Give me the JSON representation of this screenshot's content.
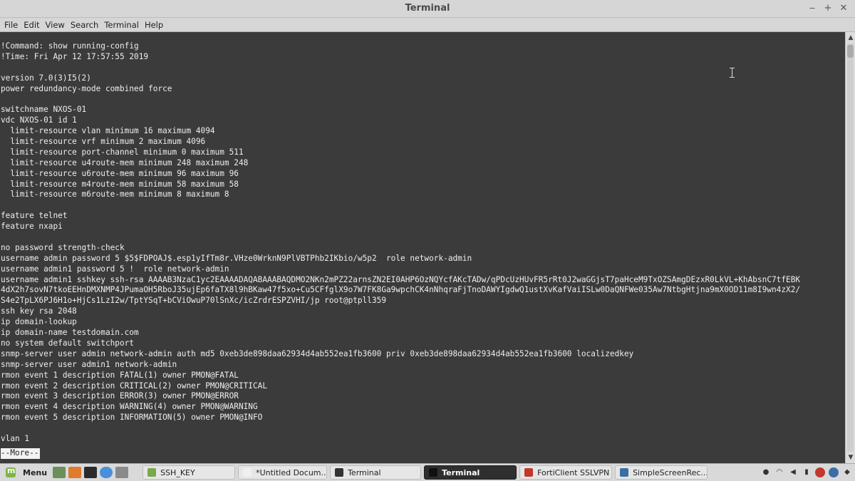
{
  "window": {
    "title": "Terminal"
  },
  "menu": [
    "File",
    "Edit",
    "View",
    "Search",
    "Terminal",
    "Help"
  ],
  "terminal": {
    "lines": [
      "!Command: show running-config",
      "!Time: Fri Apr 12 17:57:55 2019",
      "",
      "version 7.0(3)I5(2)",
      "power redundancy-mode combined force",
      "",
      "switchname NXOS-01",
      "vdc NXOS-01 id 1",
      "  limit-resource vlan minimum 16 maximum 4094",
      "  limit-resource vrf minimum 2 maximum 4096",
      "  limit-resource port-channel minimum 0 maximum 511",
      "  limit-resource u4route-mem minimum 248 maximum 248",
      "  limit-resource u6route-mem minimum 96 maximum 96",
      "  limit-resource m4route-mem minimum 58 maximum 58",
      "  limit-resource m6route-mem minimum 8 maximum 8",
      "",
      "feature telnet",
      "feature nxapi",
      "",
      "no password strength-check",
      "username admin password 5 $5$FDPOAJ$.esp1yIfTm8r.VHze0WrknN9PlVBTPhb2IKbio/w5p2  role network-admin",
      "username admin1 password 5 !  role network-admin",
      "username admin1 sshkey ssh-rsa AAAAB3NzaC1yc2EAAAADAQABAAABAQDMO2NKn2mPZ22arnsZN2EI0AHP6OzNQYcfAKcTADw/qPDcUzHUvFR5rRt0J2waGGjsT7paHceM9TxOZSAmgDEzxR0LkVL+KhAbsnC7tfEBK",
      "4dX2h7sovN7tkoEEHnDMXNMP4JPumaOH5RboJ35ujEp6faTX8l9hBKaw47f5xo+Cu5CFfglX9o7W7FK8Ga9wpchCK4nNhqraFjTnoDAWYIgdwQ1ustXvKafVaiISLw0DaQNFWe035Aw7NtbgHtjna9mX0OD11m8I9wn4zX2/",
      "S4e2TpLX6PJ6H1o+HjCs1LzI2w/TptYSqT+bCViOwuP70lSnXc/icZrdrESPZVHI/jp root@ptpll359",
      "ssh key rsa 2048",
      "ip domain-lookup",
      "ip domain-name testdomain.com",
      "no system default switchport",
      "snmp-server user admin network-admin auth md5 0xeb3de898daa62934d4ab552ea1fb3600 priv 0xeb3de898daa62934d4ab552ea1fb3600 localizedkey",
      "snmp-server user admin1 network-admin",
      "rmon event 1 description FATAL(1) owner PMON@FATAL",
      "rmon event 2 description CRITICAL(2) owner PMON@CRITICAL",
      "rmon event 3 description ERROR(3) owner PMON@ERROR",
      "rmon event 4 description WARNING(4) owner PMON@WARNING",
      "rmon event 5 description INFORMATION(5) owner PMON@INFO",
      "",
      "vlan 1"
    ],
    "pager": "--More--"
  },
  "taskbar": {
    "menu_label": "Menu",
    "tasks": [
      {
        "label": "SSH_KEY",
        "active": false,
        "icon_color": "#7aa84a"
      },
      {
        "label": "*Untitled Docum...",
        "active": false,
        "icon_color": "#f0f0f0"
      },
      {
        "label": "Terminal",
        "active": false,
        "icon_color": "#333333"
      },
      {
        "label": "Terminal",
        "active": true,
        "icon_color": "#111111"
      },
      {
        "label": "FortiClient SSLVPN",
        "active": false,
        "icon_color": "#c0392b"
      },
      {
        "label": "SimpleScreenRec...",
        "active": false,
        "icon_color": "#3a6ea5"
      }
    ]
  }
}
